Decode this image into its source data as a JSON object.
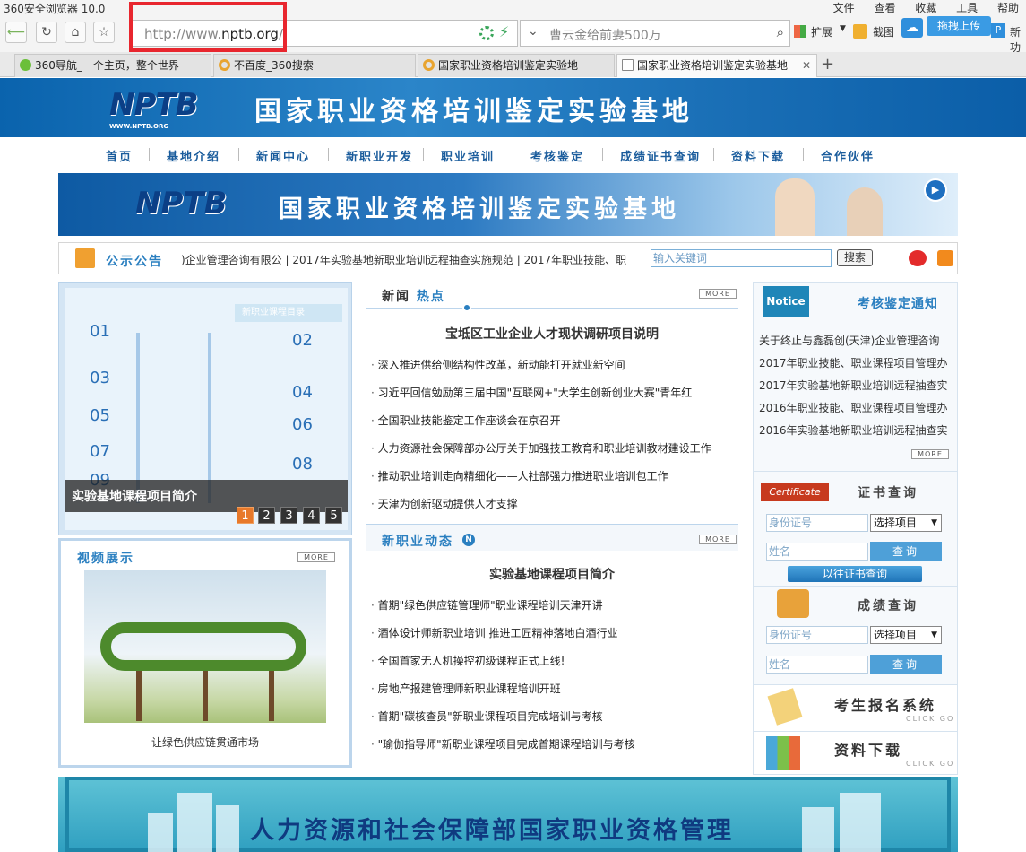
{
  "browser": {
    "title": "360安全浏览器 10.0",
    "menu": [
      "文件",
      "查看",
      "收藏",
      "工具",
      "帮助"
    ],
    "url_prefix": "http://www.",
    "url_domain": "nptb.org",
    "url_suffix": "/",
    "search_placeholder": "曹云金给前妻500万",
    "extensions_label": "扩展",
    "screenshot_label": "截图",
    "upload_label": "拖拽上传",
    "extra_label": "新功",
    "tabs": [
      {
        "label": "360导航_一个主页，整个世界"
      },
      {
        "label": "不百度_360搜索"
      },
      {
        "label": "国家职业资格培训鉴定实验地"
      },
      {
        "label": "国家职业资格培训鉴定实验基地"
      }
    ]
  },
  "header": {
    "logo": "NPTB",
    "logo_sub": "WWW.NPTB.ORG",
    "title": "国家职业资格培训鉴定实验基地"
  },
  "nav": [
    "首页",
    "基地介绍",
    "新闻中心",
    "新职业开发",
    "职业培训",
    "考核鉴定",
    "成绩证书查询",
    "资料下载",
    "合作伙伴"
  ],
  "banner": {
    "logo": "NPTB",
    "title": "国家职业资格培训鉴定实验基地"
  },
  "notice_bar": {
    "label": "公示公告",
    "marquee": ")企业管理咨询有限公 | 2017年实验基地新职业培训远程抽查实施规范 | 2017年职业技能、职",
    "keyword_placeholder": "输入关键词",
    "search_label": "搜索"
  },
  "slideshow": {
    "caption": "实验基地课程项目简介",
    "pages": [
      "1",
      "2",
      "3",
      "4",
      "5"
    ],
    "active_page": 1,
    "poster_title": "新职业课程目录",
    "poster_numbers": [
      "01",
      "02",
      "03",
      "04",
      "05",
      "06",
      "07",
      "08",
      "09"
    ]
  },
  "video": {
    "heading": "视频展示",
    "more": "MORE",
    "caption": "让绿色供应链贯通市场"
  },
  "news_hot": {
    "heading_a": "新闻",
    "heading_b": "热点",
    "more": "MORE",
    "headline": "宝坻区工业企业人才现状调研项目说明",
    "items": [
      "深入推进供给侧结构性改革，新动能打开就业新空间",
      "习近平回信勉励第三届中国\"互联网+\"大学生创新创业大赛\"青年红",
      "全国职业技能鉴定工作座谈会在京召开",
      "人力资源社会保障部办公厅关于加强技工教育和职业培训教材建设工作",
      "推动职业培训走向精细化——人社部强力推进职业培训包工作",
      "天津为创新驱动提供人才支撑"
    ]
  },
  "new_jobs": {
    "heading": "新职业动态",
    "icon": "N",
    "more": "MORE",
    "headline": "实验基地课程项目简介",
    "items": [
      "首期\"绿色供应链管理师\"职业课程培训天津开讲",
      "酒体设计师新职业培训 推进工匠精神落地白酒行业",
      "全国首家无人机操控初级课程正式上线!",
      "房地产报建管理师新职业课程培训开班",
      "首期\"碳核查员\"新职业课程项目完成培训与考核",
      "\"瑜伽指导师\"新职业课程项目完成首期课程培训与考核"
    ]
  },
  "exam_notice": {
    "badge": "Notice",
    "heading": "考核鉴定通知",
    "more": "MORE",
    "items": [
      "关于终止与鑫磊创(天津)企业管理咨询",
      "2017年职业技能、职业课程项目管理办",
      "2017年实验基地新职业培训远程抽查实",
      "2016年职业技能、职业课程项目管理办",
      "2016年实验基地新职业培训远程抽查实"
    ]
  },
  "cert_query": {
    "badge": "Certificate",
    "heading": "证书查询",
    "id_placeholder": "身份证号",
    "select_value": "选择项目",
    "name_placeholder": "姓名",
    "button": "查询",
    "old_button": "以往证书查询"
  },
  "score_query": {
    "heading": "成绩查询",
    "id_placeholder": "身份证号",
    "select_value": "选择项目",
    "name_placeholder": "姓名",
    "button": "查询"
  },
  "signup": {
    "label": "考生报名系统",
    "sub": "CLICK GO"
  },
  "download": {
    "label": "资料下载",
    "sub": "CLICK GO"
  },
  "bottom_banner": {
    "title": "人力资源和社会保障部国家职业资格管理"
  },
  "colors": {
    "accent": "#2a7fc0",
    "nav_text": "#1a5c9c",
    "highlight_box": "#e8262e",
    "page_active": "#e8792a"
  }
}
